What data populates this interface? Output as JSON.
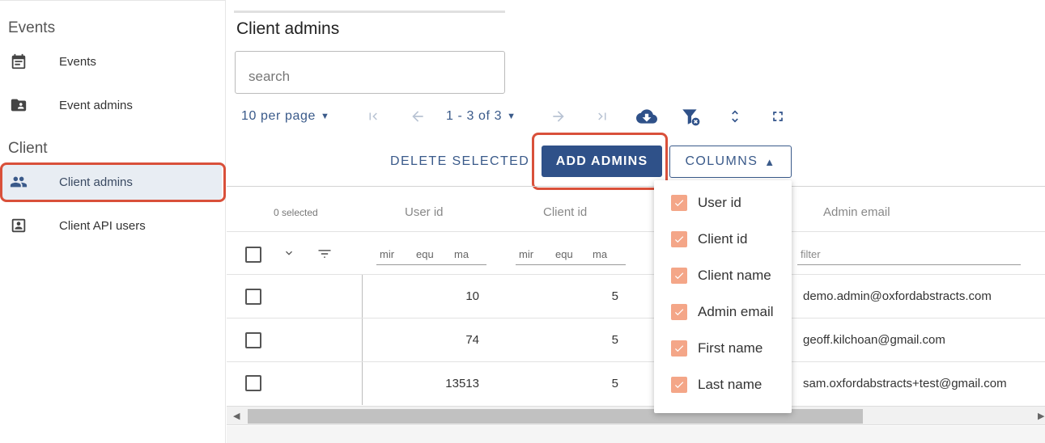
{
  "sidebar": {
    "sections": [
      {
        "heading": "Events",
        "items": [
          {
            "label": "Events",
            "icon": "calendar-icon"
          },
          {
            "label": "Event admins",
            "icon": "folder-person-icon"
          }
        ]
      },
      {
        "heading": "Client",
        "items": [
          {
            "label": "Client admins",
            "icon": "people-icon",
            "active": true
          },
          {
            "label": "Client API users",
            "icon": "badge-icon"
          }
        ]
      }
    ]
  },
  "main": {
    "title": "Client admins",
    "search": {
      "placeholder": "search",
      "value": ""
    },
    "pager": {
      "per_page": "10 per page",
      "range": "1 - 3 of 3"
    },
    "actions": {
      "delete_label": "DELETE SELECTED",
      "add_label": "ADD ADMINS",
      "columns_label": "COLUMNS"
    }
  },
  "table": {
    "selected_count": "0 selected",
    "headers": [
      "User id",
      "Client id",
      "Admin email"
    ],
    "range_filter_labels": [
      "mir",
      "equ",
      "ma"
    ],
    "email_filter_placeholder": "filter",
    "rows": [
      {
        "user_id": "10",
        "client_id": "5",
        "admin_email": "demo.admin@oxfordabstracts.com"
      },
      {
        "user_id": "74",
        "client_id": "5",
        "admin_email": "geoff.kilchoan@gmail.com"
      },
      {
        "user_id": "13513",
        "client_id": "5",
        "admin_email": "sam.oxfordabstracts+test@gmail.com"
      }
    ]
  },
  "columns_menu": {
    "items": [
      {
        "label": "User id",
        "checked": true
      },
      {
        "label": "Client id",
        "checked": true
      },
      {
        "label": "Client name",
        "checked": true
      },
      {
        "label": "Admin email",
        "checked": true
      },
      {
        "label": "First name",
        "checked": true
      },
      {
        "label": "Last name",
        "checked": true
      }
    ]
  },
  "colors": {
    "accent": "#2f5189",
    "highlight": "#d9503a",
    "checkbox": "#f4a688"
  }
}
